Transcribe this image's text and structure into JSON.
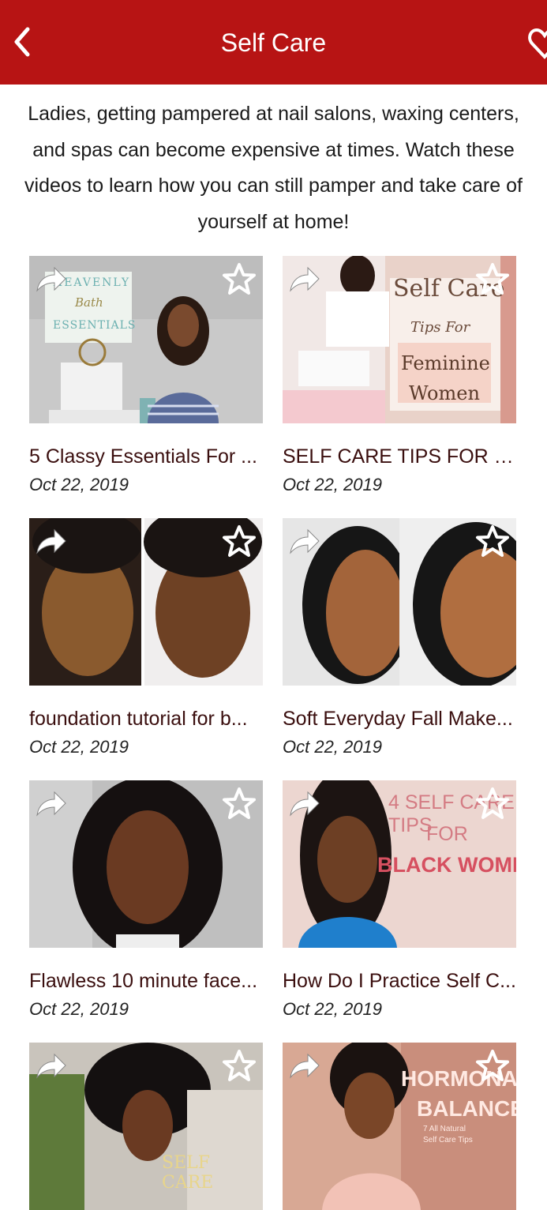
{
  "header": {
    "title": "Self Care",
    "back_icon": "chevron-left-icon",
    "favorite_icon": "heart-icon",
    "background": "#b71414"
  },
  "intro": {
    "text": "Ladies, getting pampered at nail salons, waxing centers, and spas can become expensive at times. Watch these videos to learn how you can still pamper and take care of yourself at home!"
  },
  "videos": [
    {
      "title": "5 Classy Essentials For ...",
      "date": "Oct 22, 2019",
      "thumb_text": [
        "HEAVENLY",
        "Bath",
        "ESSENTIALS"
      ]
    },
    {
      "title": "SELF CARE TIPS FOR FE...",
      "date": "Oct 22, 2019",
      "thumb_text": [
        "Self Care",
        "Tips For",
        "Feminine",
        "Women"
      ]
    },
    {
      "title": "foundation tutorial for b...",
      "date": "Oct 22, 2019",
      "thumb_text": []
    },
    {
      "title": "Soft Everyday Fall Make...",
      "date": "Oct 22, 2019",
      "thumb_text": []
    },
    {
      "title": "Flawless 10 minute face...",
      "date": "Oct 22, 2019",
      "thumb_text": []
    },
    {
      "title": "How Do I Practice Self C...",
      "date": "Oct 22, 2019",
      "thumb_text": [
        "4 SELF CARE TIPS",
        "FOR",
        "BLACK WOMEN"
      ]
    },
    {
      "title": "",
      "date": "",
      "thumb_text": [
        "SELF CARE"
      ]
    },
    {
      "title": "",
      "date": "",
      "thumb_text": [
        "HORMONAL",
        "BALANCE",
        "7 All Natural",
        "Self Care Tips"
      ]
    }
  ]
}
